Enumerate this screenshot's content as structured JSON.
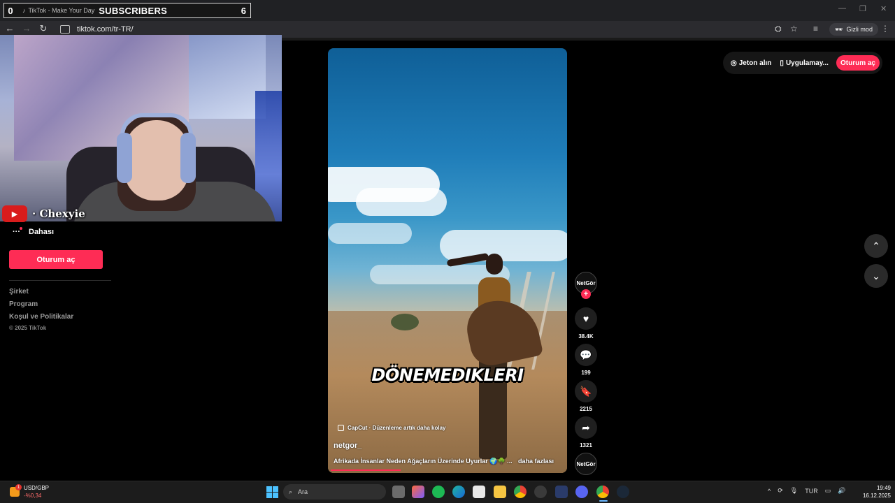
{
  "overlay": {
    "left_count": "0",
    "tab_label": "TikTok - Make Your Day",
    "title": "SUBSCRIBERS",
    "right_count": "6"
  },
  "browser": {
    "url": "tiktok.com/tr-TR/",
    "incognito_label": "Gizli mod"
  },
  "stream": {
    "streamer_name": "· Chexyie"
  },
  "sidebar": {
    "more_label": "Dahası",
    "login_label": "Oturum aç",
    "footer_links": [
      "Şirket",
      "Program",
      "Koşul ve Politikalar"
    ],
    "copyright": "© 2025 TikTok"
  },
  "header": {
    "coins_label": "Jeton alın",
    "app_label": "Uygulamay...",
    "login_label": "Oturum aç"
  },
  "video": {
    "overlay_caption": "DÖNEMEDIKLERI",
    "capcut_label": "CapCut · Düzenleme artık daha kolay",
    "author": "netgor_",
    "description": "Afrikada İnsanlar Neden Ağaçların Üzerinde Uyurlar 🌍🌳 ...",
    "more_label": "daha fazlası",
    "avatar_label": "NetGör",
    "likes": "38.4K",
    "comments": "199",
    "saves": "2215",
    "shares": "1321",
    "sound_label": "NetGör",
    "progress_fraction": 0.3
  },
  "taskbar": {
    "ticker_name": "USD/GBP",
    "ticker_change": "-%0,34",
    "ticker_badge": "1",
    "search_placeholder": "Ara",
    "language": "TUR",
    "time": "19:49",
    "date": "16.12.2025"
  },
  "colors": {
    "accent": "#fe2c55",
    "background": "#000000"
  }
}
